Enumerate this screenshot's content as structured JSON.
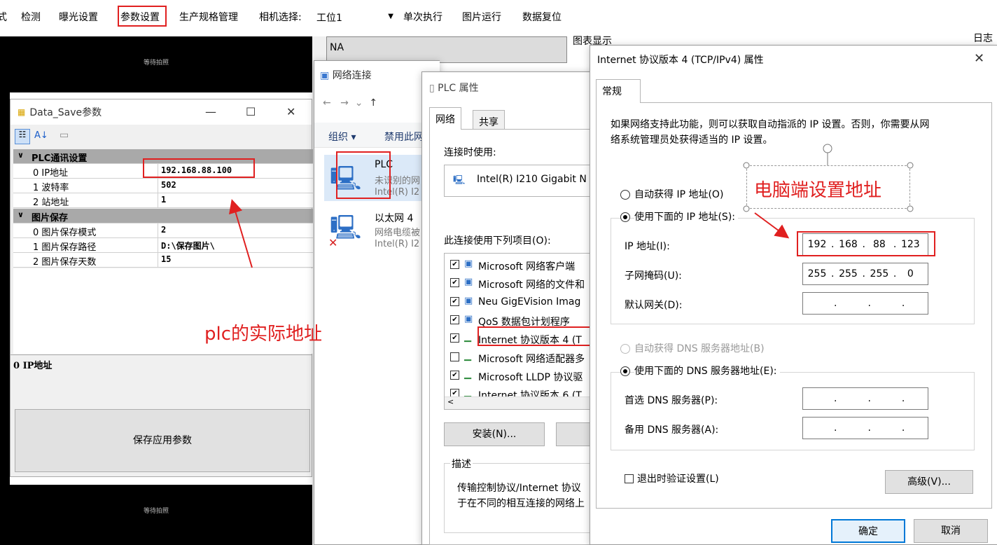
{
  "menu": {
    "items": [
      "检测",
      "曝光设置",
      "参数设置",
      "生产规格管理",
      "相机选择:",
      "单次执行",
      "图片运行",
      "数据复位"
    ],
    "camera_value": "工位1",
    "left_fragment": "式"
  },
  "camera_panes": {
    "caption": "等待拍照"
  },
  "na_label": "NA",
  "chart_label": "图表显示",
  "log_label": "日志",
  "data_save": {
    "title": "Data_Save参数",
    "cat1": "PLC通讯设置",
    "rows1": [
      {
        "name": "0 IP地址",
        "value": "192.168.88.100"
      },
      {
        "name": "1 波特率",
        "value": "502"
      },
      {
        "name": "2 站地址",
        "value": "1"
      }
    ],
    "cat2": "图片保存",
    "rows2": [
      {
        "name": "0 图片保存模式",
        "value": "2"
      },
      {
        "name": "1 图片保存路径",
        "value": "D:\\保存图片\\"
      },
      {
        "name": "2 图片保存天数",
        "value": "15"
      }
    ],
    "desc_title": "0 IP地址",
    "save_button": "保存应用参数"
  },
  "network_conn": {
    "title": "网络连接",
    "organize": "组织 ▾",
    "disable": "禁用此网",
    "item1": {
      "name": "PLC",
      "status": "未识别的网",
      "adapter": "Intel(R) I2"
    },
    "item2": {
      "name": "以太网 4",
      "status": "网络电缆被",
      "adapter": "Intel(R) I2"
    }
  },
  "plc_props": {
    "title": "PLC 属性",
    "tabs": [
      "网络",
      "共享"
    ],
    "connect_using": "连接时使用:",
    "adapter": "Intel(R) I210 Gigabit N",
    "items_label": "此连接使用下列项目(O):",
    "items": [
      {
        "label": "Microsoft 网络客户端",
        "checked": true
      },
      {
        "label": "Microsoft 网络的文件和",
        "checked": true
      },
      {
        "label": "Neu GigEVision Imag",
        "checked": true
      },
      {
        "label": "QoS 数据包计划程序",
        "checked": true
      },
      {
        "label": "Internet 协议版本 4 (T",
        "checked": true
      },
      {
        "label": "Microsoft 网络适配器多",
        "checked": false
      },
      {
        "label": "Microsoft LLDP 协议驱",
        "checked": true
      },
      {
        "label": "Internet 协议版本 6 (T",
        "checked": true
      }
    ],
    "install_button": "安装(N)...",
    "desc_label": "描述",
    "desc_text1": "传输控制协议/Internet 协议",
    "desc_text2": "于在不同的相互连接的网络上"
  },
  "ipv4": {
    "title": "Internet 协议版本 4 (TCP/IPv4) 属性",
    "tab": "常规",
    "intro1": "如果网络支持此功能，则可以获取自动指派的 IP 设置。否则，你需要从网",
    "intro2": "络系统管理员处获得适当的 IP 设置。",
    "auto_ip": "自动获得 IP 地址(O)",
    "manual_ip": "使用下面的 IP 地址(S):",
    "ip_label": "IP 地址(I):",
    "ip_value": [
      "192",
      "168",
      "88",
      "123"
    ],
    "mask_label": "子网掩码(U):",
    "mask_value": [
      "255",
      "255",
      "255",
      "0"
    ],
    "gateway_label": "默认网关(D):",
    "auto_dns": "自动获得 DNS 服务器地址(B)",
    "manual_dns": "使用下面的 DNS 服务器地址(E):",
    "dns1_label": "首选 DNS 服务器(P):",
    "dns2_label": "备用 DNS 服务器(A):",
    "validate": "退出时验证设置(L)",
    "advanced": "高级(V)...",
    "ok": "确定",
    "cancel": "取消"
  },
  "annotations": {
    "plc_address": "plc的实际地址",
    "pc_address": "电脑端设置地址"
  },
  "colors": {
    "accent_red": "#e02020",
    "category_gray": "#a9a9a9"
  }
}
